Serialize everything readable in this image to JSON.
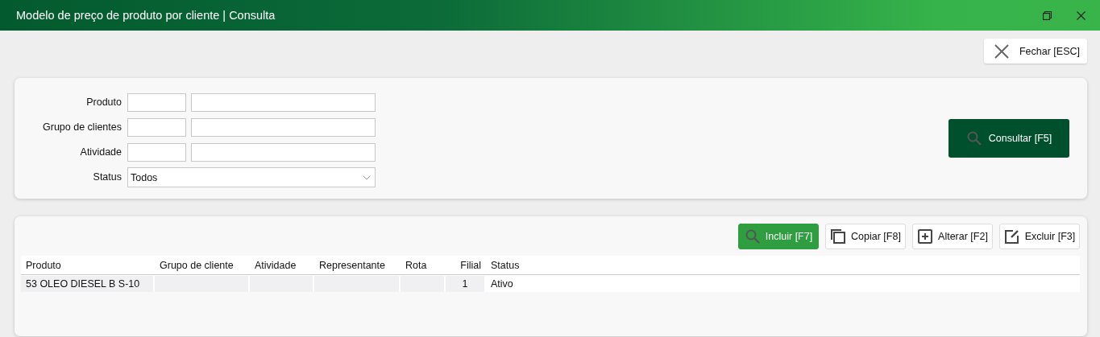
{
  "window": {
    "title": "Modelo de preço de produto por cliente | Consulta"
  },
  "close_button": {
    "label": "Fechar [ESC]"
  },
  "filters": [
    {
      "kind": "lookup",
      "label": "Produto"
    },
    {
      "kind": "lookup",
      "label": "Grupo de clientes"
    },
    {
      "kind": "lookup",
      "label": "Atividade"
    },
    {
      "kind": "select",
      "label": "Status",
      "value": "Todos"
    }
  ],
  "search_button": {
    "label": "Consultar [F5]"
  },
  "toolbar": [
    {
      "kind": "primary",
      "label": "Incluir [F7]"
    },
    {
      "kind": "secondary",
      "label": "Copiar [F8]"
    },
    {
      "kind": "secondary",
      "label": "Alterar [F2]"
    },
    {
      "kind": "secondary",
      "label": "Excluir [F3]"
    }
  ],
  "table": {
    "columns": [
      "Produto",
      "Grupo de cliente",
      "Atividade",
      "Representante",
      "Rota",
      "Filial",
      "Status"
    ],
    "rows": [
      [
        "53 OLEO DIESEL B S-10",
        "",
        "",
        "",
        "",
        "1",
        "Ativo"
      ]
    ]
  }
}
